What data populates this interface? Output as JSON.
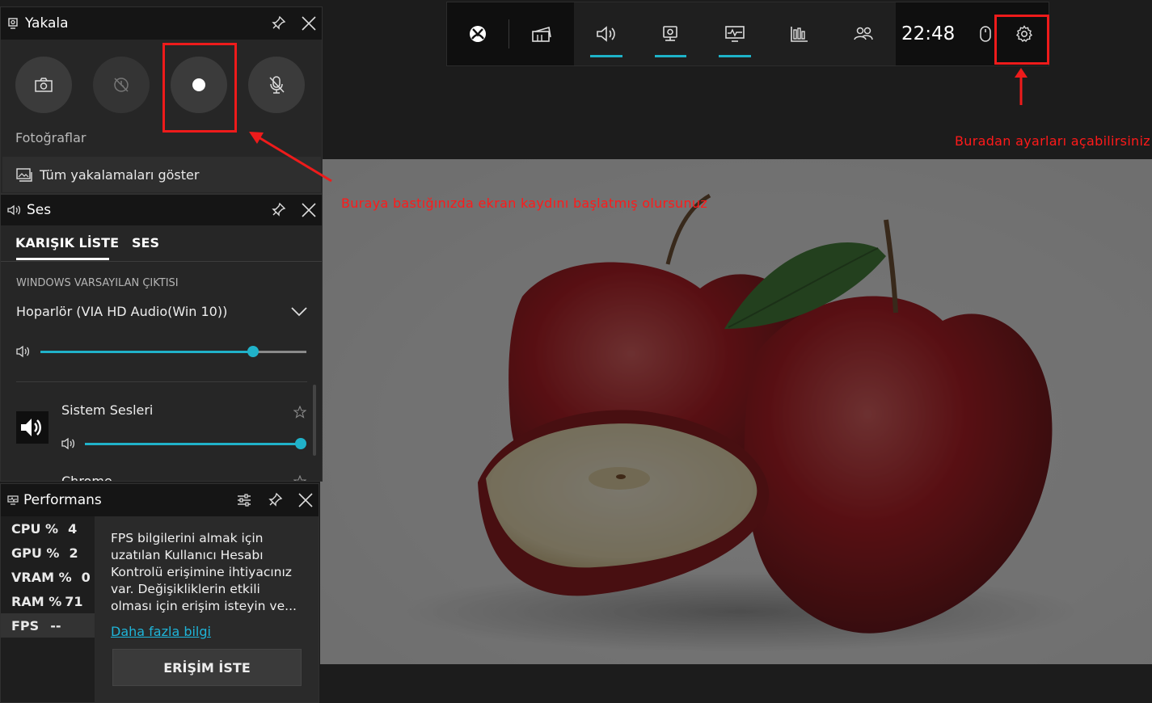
{
  "topbar": {
    "clock": "22:48",
    "icons": [
      "xbox-icon",
      "widget-icon",
      "audio-icon",
      "capture-icon",
      "performance-icon",
      "resources-icon",
      "social-icon",
      "mouse-icon",
      "settings-icon"
    ]
  },
  "capture": {
    "title": "Yakala",
    "photos_label": "Fotoğraflar",
    "show_all": "Tüm yakalamaları göster"
  },
  "audio": {
    "title": "Ses",
    "tabs": [
      "KARIŞIK LİSTE",
      "SES"
    ],
    "output_header": "WINDOWS VARSAYILAN ÇIKTISI",
    "device": "Hoparlör (VIA HD Audio(Win 10))",
    "master_volume": 0.8,
    "apps": [
      {
        "name": "Sistem Sesleri",
        "volume": 1.0
      },
      {
        "name": "Chrome"
      }
    ]
  },
  "performance": {
    "title": "Performans",
    "rows": [
      {
        "label": "CPU %",
        "value": "4"
      },
      {
        "label": "GPU %",
        "value": "2"
      },
      {
        "label": "VRAM %",
        "value": "0"
      },
      {
        "label": "RAM %",
        "value": "71"
      },
      {
        "label": "FPS",
        "value": "--"
      }
    ],
    "fps_message": "FPS bilgilerini almak için uzatılan Kullanıcı Hesabı Kontrolü erişimine ihtiyacınız var. Değişikliklerin etkili olması için erişim isteyin ve...",
    "more_info": "Daha fazla bilgi",
    "request_button": "ERİŞİM İSTE"
  },
  "annotations": {
    "settings_hint": "Buradan ayarları açabilirsiniz",
    "record_hint": "Buraya bastığınızda ekran kaydını başlatmış olursunuz"
  },
  "colors": {
    "accent": "#20b2c9",
    "annotation": "#ee1b1b"
  }
}
